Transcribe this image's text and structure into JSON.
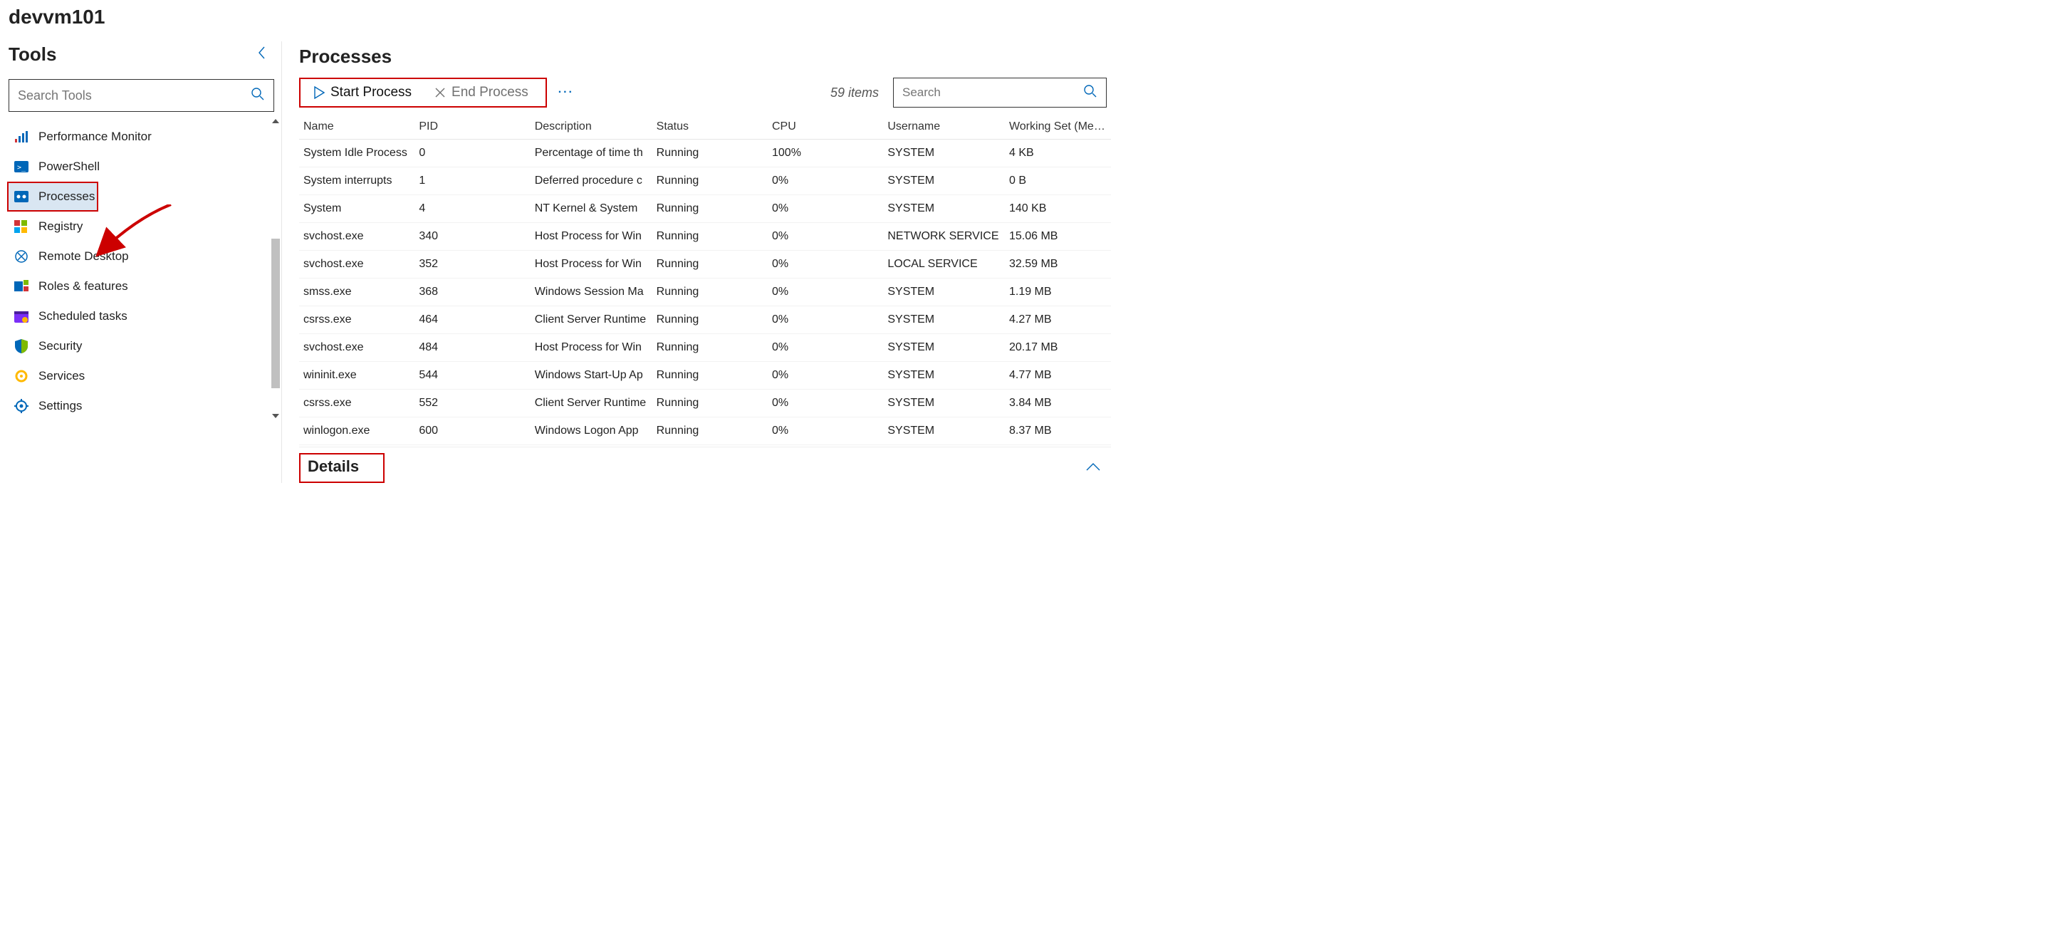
{
  "hostname": "devvm101",
  "sidebar": {
    "title": "Tools",
    "search_placeholder": "Search Tools",
    "items": [
      {
        "label": "Performance Monitor",
        "icon": "perf-monitor-icon"
      },
      {
        "label": "PowerShell",
        "icon": "powershell-icon"
      },
      {
        "label": "Processes",
        "icon": "processes-icon",
        "active": true,
        "highlight": true
      },
      {
        "label": "Registry",
        "icon": "registry-icon"
      },
      {
        "label": "Remote Desktop",
        "icon": "remote-desktop-icon"
      },
      {
        "label": "Roles & features",
        "icon": "roles-features-icon"
      },
      {
        "label": "Scheduled tasks",
        "icon": "scheduled-tasks-icon"
      },
      {
        "label": "Security",
        "icon": "security-icon"
      },
      {
        "label": "Services",
        "icon": "services-icon"
      },
      {
        "label": "Settings",
        "icon": "settings-icon"
      }
    ]
  },
  "main": {
    "title": "Processes",
    "toolbar": {
      "start_label": "Start Process",
      "end_label": "End Process"
    },
    "item_count": "59 items",
    "search_placeholder": "Search",
    "columns": {
      "name": "Name",
      "pid": "PID",
      "description": "Description",
      "status": "Status",
      "cpu": "CPU",
      "username": "Username",
      "working_set": "Working Set (Me…"
    },
    "rows": [
      {
        "name": "System Idle Process",
        "pid": "0",
        "desc": "Percentage of time th",
        "status": "Running",
        "cpu": "100%",
        "user": "SYSTEM",
        "ws": "4 KB"
      },
      {
        "name": "System interrupts",
        "pid": "1",
        "desc": "Deferred procedure c",
        "status": "Running",
        "cpu": "0%",
        "user": "SYSTEM",
        "ws": "0 B"
      },
      {
        "name": "System",
        "pid": "4",
        "desc": "NT Kernel & System",
        "status": "Running",
        "cpu": "0%",
        "user": "SYSTEM",
        "ws": "140 KB"
      },
      {
        "name": "svchost.exe",
        "pid": "340",
        "desc": "Host Process for Win",
        "status": "Running",
        "cpu": "0%",
        "user": "NETWORK SERVICE",
        "ws": "15.06 MB"
      },
      {
        "name": "svchost.exe",
        "pid": "352",
        "desc": "Host Process for Win",
        "status": "Running",
        "cpu": "0%",
        "user": "LOCAL SERVICE",
        "ws": "32.59 MB"
      },
      {
        "name": "smss.exe",
        "pid": "368",
        "desc": "Windows Session Ma",
        "status": "Running",
        "cpu": "0%",
        "user": "SYSTEM",
        "ws": "1.19 MB"
      },
      {
        "name": "csrss.exe",
        "pid": "464",
        "desc": "Client Server Runtime",
        "status": "Running",
        "cpu": "0%",
        "user": "SYSTEM",
        "ws": "4.27 MB"
      },
      {
        "name": "svchost.exe",
        "pid": "484",
        "desc": "Host Process for Win",
        "status": "Running",
        "cpu": "0%",
        "user": "SYSTEM",
        "ws": "20.17 MB"
      },
      {
        "name": "wininit.exe",
        "pid": "544",
        "desc": "Windows Start-Up Ap",
        "status": "Running",
        "cpu": "0%",
        "user": "SYSTEM",
        "ws": "4.77 MB"
      },
      {
        "name": "csrss.exe",
        "pid": "552",
        "desc": "Client Server Runtime",
        "status": "Running",
        "cpu": "0%",
        "user": "SYSTEM",
        "ws": "3.84 MB"
      },
      {
        "name": "winlogon.exe",
        "pid": "600",
        "desc": "Windows Logon App",
        "status": "Running",
        "cpu": "0%",
        "user": "SYSTEM",
        "ws": "8.37 MB"
      }
    ],
    "details_title": "Details"
  }
}
